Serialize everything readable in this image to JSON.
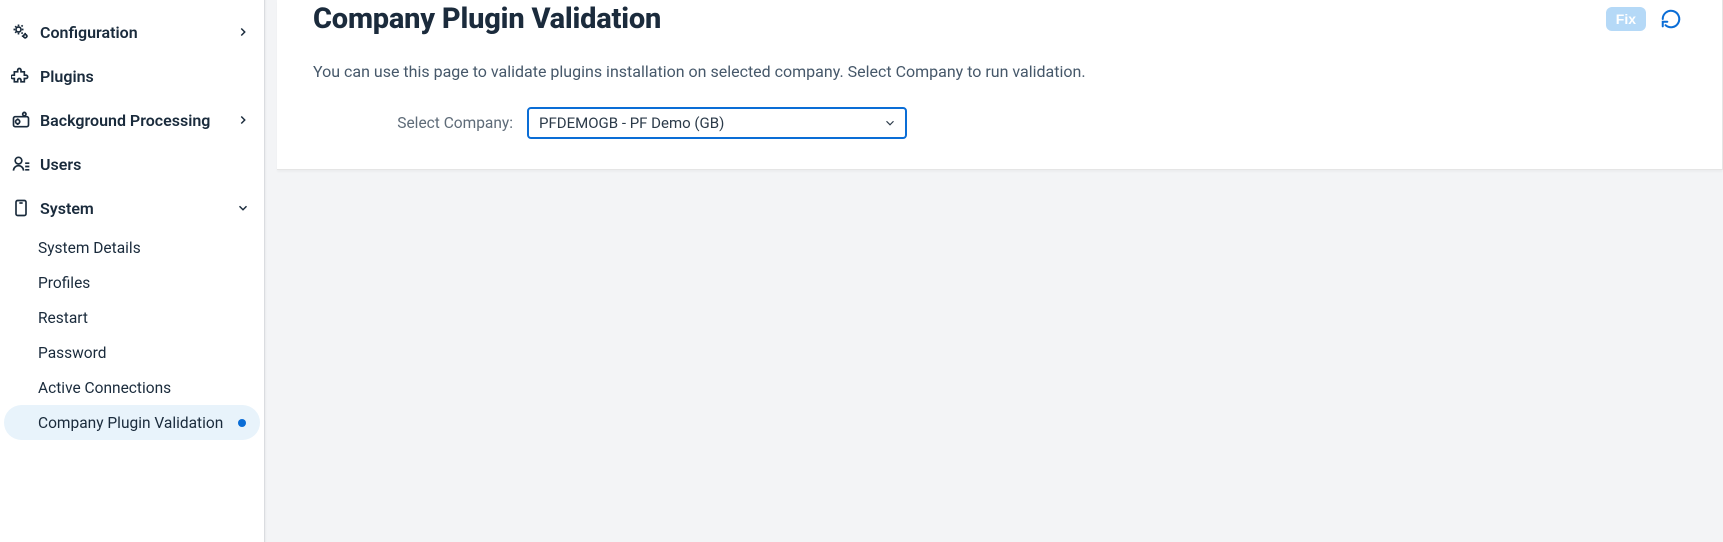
{
  "sidebar": {
    "items": [
      {
        "label": "Configuration",
        "expandable": true
      },
      {
        "label": "Plugins",
        "expandable": false
      },
      {
        "label": "Background Processing",
        "expandable": true
      },
      {
        "label": "Users",
        "expandable": false
      },
      {
        "label": "System",
        "expandable": true,
        "expanded": true,
        "children": [
          {
            "label": "System Details"
          },
          {
            "label": "Profiles"
          },
          {
            "label": "Restart"
          },
          {
            "label": "Password"
          },
          {
            "label": "Active Connections"
          },
          {
            "label": "Company Plugin Validation",
            "active": true
          }
        ]
      }
    ]
  },
  "page": {
    "title": "Company Plugin Validation",
    "description": "You can use this page to validate plugins installation on selected company. Select Company to run validation.",
    "fix_label": "Fix",
    "form": {
      "select_company_label": "Select Company:",
      "selected_company": "PFDEMOGB - PF Demo (GB)"
    }
  }
}
